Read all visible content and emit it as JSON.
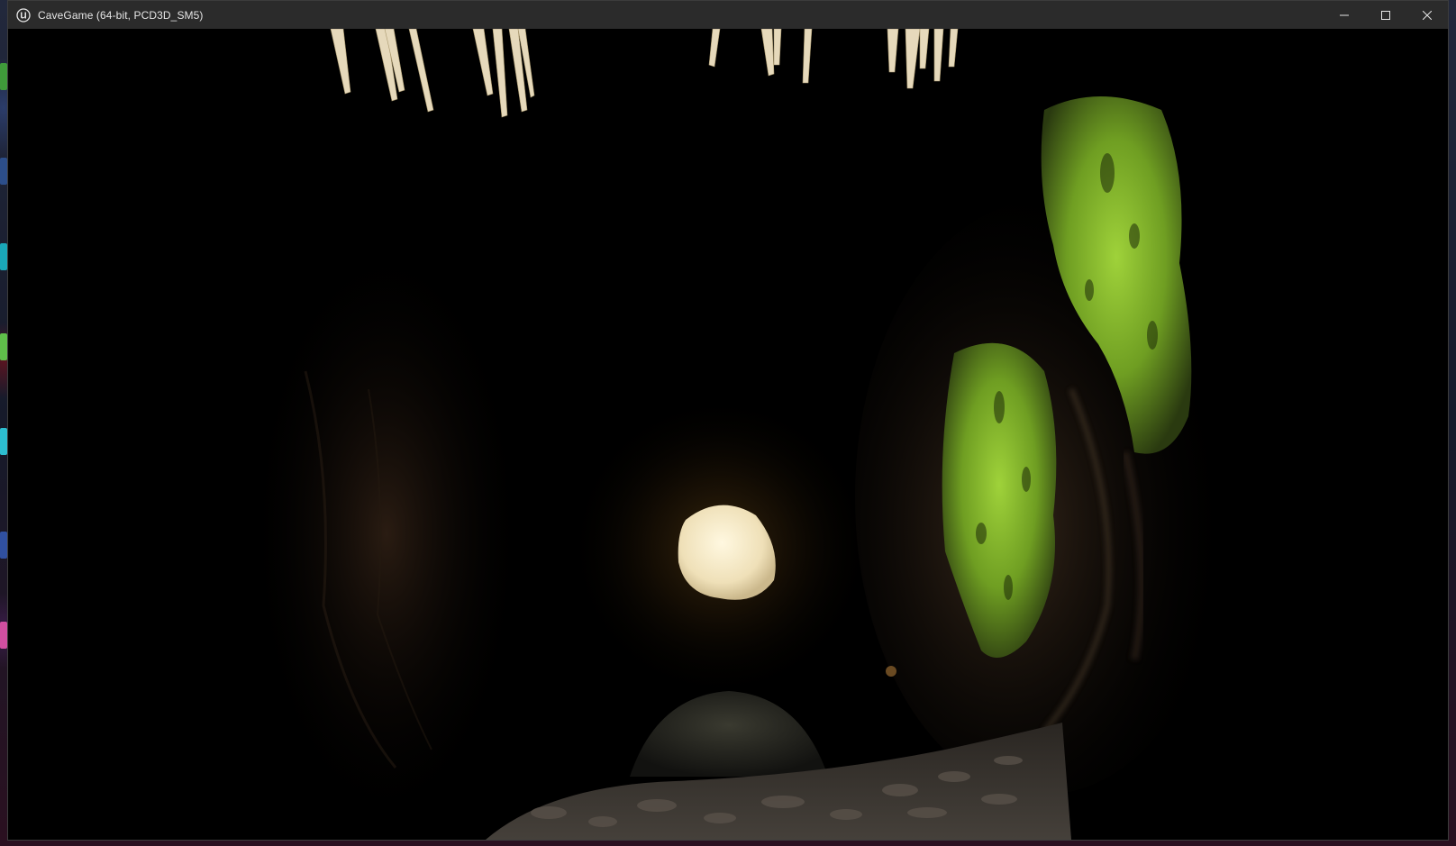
{
  "window": {
    "title": "CaveGame (64-bit, PCD3D_SM5)",
    "app_icon": "unreal-engine-logo",
    "controls": {
      "minimize_icon": "minimize-icon",
      "maximize_icon": "maximize-icon",
      "close_icon": "close-icon"
    }
  },
  "scene": {
    "description_items": [
      "stalactites",
      "glowing-stone",
      "moss-covered-rock-wall",
      "boulder",
      "pebble-floor"
    ],
    "colors": {
      "background": "#000000",
      "moss": "#8bbf2a",
      "stone_glow": "#f3e8c8",
      "stalactite": "#e8dcc0",
      "floor": "#3a3632"
    }
  },
  "desktop": {
    "icons": [
      "desktop-icon-green",
      "desktop-icon-blue",
      "desktop-icon-red",
      "desktop-icon-cyan",
      "desktop-icon-pink"
    ]
  }
}
